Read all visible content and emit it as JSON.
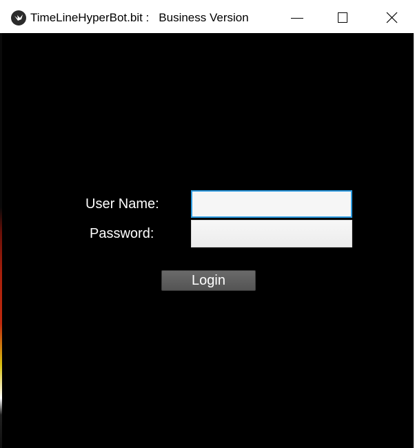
{
  "window": {
    "title": "TimeLineHyperBot.bit :",
    "subtitle": "Business Version",
    "app_icon": "kivy-logo-icon",
    "controls": {
      "minimize_icon": "minimize-icon",
      "maximize_icon": "maximize-icon",
      "close_icon": "close-icon"
    }
  },
  "login_form": {
    "username_label": "User Name:",
    "username_value": "",
    "password_label": "Password:",
    "password_value": "",
    "login_button_label": "Login"
  },
  "colors": {
    "background": "#000000",
    "label_text": "#ffffff",
    "focus_border": "#2e9be0",
    "button_fill": "#5e5e5e"
  }
}
